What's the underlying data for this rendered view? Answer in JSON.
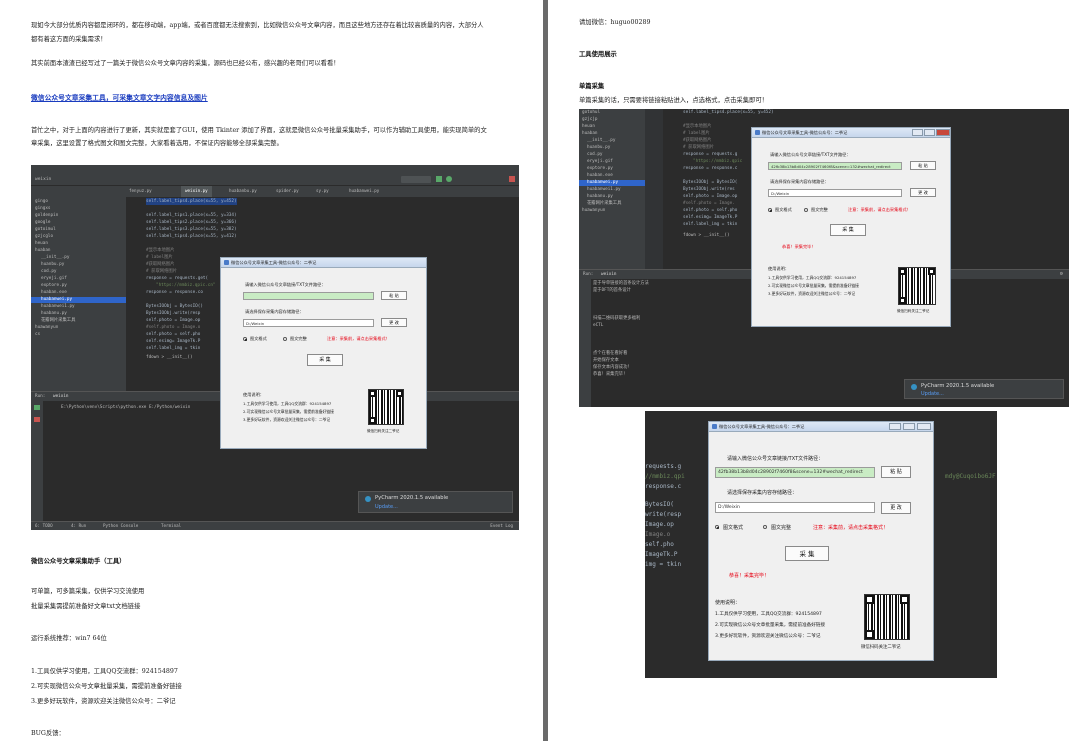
{
  "left_page": {
    "intro_1": "现如今大部分优质内容都是闭环的，都在移动端，app端，或者百度都无法搜索到，比如微信公众号文章内容，而且这些地方还存在着比较高质量的内容，大部分人",
    "intro_2": "都有着这方面的采集需求！",
    "intro_3": "其实前面本渣渣已经写过了一篇关于微信公众号文章内容的采集，源码也已经公布，感兴趣的老哥们可以看看！",
    "link_text": "微信公众号文章采集工具，可采集文章文字内容信息及图片",
    "update_1": "首忙之中，对于上面的内容进行了更新，其实就是套了GUI，使用 Tkinter 添加了界面，这就是微信公众号批量采集助手，可以作为辅助工具使用，能实现简单的文",
    "update_2": "章采集，这里设置了格式图文和图文完整，大家看着选用，不保证内容能够全部采集完整。",
    "section_title": "微信公众号文章采集助手（工具）",
    "p1": "可单篇，可多篇采集，仅供学习交流使用",
    "p2": "批量采集需提前准备好文章txt文档链接",
    "sys_req": "运行系统推荐：win7 64位",
    "note_1": "1.工具仅供学习使用，工具QQ交流群：924154897",
    "note_2": "2.可实现微信公众号文章批量采集，需提前准备好链接",
    "note_3": "3.更多好玩软件，资源欢迎关注微信公众号：二爷记",
    "bug": "BUG反馈："
  },
  "right_page": {
    "contact": "请加微信：huguo00289",
    "section_title": "工具使用展示",
    "single_title": "单篇采集",
    "single_desc": "单篇采集的话，只需要将链接粘贴进入，点选格式，点击采集即可！"
  },
  "ide_main": {
    "window_title": "weixin",
    "tabs": [
      "fenyuz.py",
      "weixin.py",
      "huabanbu.py",
      "spider.py",
      "sy.py",
      "huabanwei.py"
    ],
    "run_tab": "weixin",
    "run_cmd": "E:\\Python\\venv\\Scripts\\python.exe E:/Python/weixin",
    "status_items": [
      "6: TODO",
      "4: Run",
      "Python Console",
      "Terminal",
      "Event Log"
    ],
    "tree": [
      "gingo",
      "gingxs",
      "goldenpin",
      "google",
      "gotoimul",
      "gzjcglo",
      "heuan",
      "huaban",
      "__init__.py",
      "huanbu.py",
      "cod.py",
      "eryeji.gif",
      "exptore.py",
      "huaban.exe",
      "huabanwei.py",
      "huabanwei1.py",
      "huabanu.py",
      "花瓣网片采集工具",
      "huawanyun",
      "cs"
    ],
    "code": [
      "self.label_tips4.place(x=55, y=452)",
      "self.label_tips1.place(x=55, y=334)",
      "self.label_tips2.place(x=55, y=366)",
      "self.label_tips3.place(x=55, y=382)",
      "self.label_tips4.place(x=55, y=412)",
      "#显示本地图片",
      "# label图片",
      "#获取网络图片",
      "# 获取网络图片",
      "response = requests.get(",
      "\"https://mmbiz.qpic.cn\"",
      "response = response.co",
      "BytesIOObj = BytesIO()",
      "BytesIOObj.write(resp",
      "self.photo = Image.op",
      "#self.photo = Image.o",
      "self.photo = self.pho",
      "self.esimg= ImageTk.P",
      "self.label_img = tkin",
      "fdown > __init__()"
    ],
    "notification_title": "PyCharm 2020.1.5 available",
    "notification_link": "Update..."
  },
  "ide_right": {
    "tree": [
      "gotohul",
      "gzjcjp",
      "heuan",
      "huaban",
      "__init__.py",
      "huanbu.py",
      "cod.py",
      "eryeji.gif",
      "exptore.py",
      "huaban.exe",
      "huabanwei.py",
      "huabanwei1.py",
      "huabanu.py",
      "花瓣网片采集工具",
      "huawanyun"
    ],
    "code": [
      "self.label_tips4.place(x=55, y=452)",
      "#显示本地图片",
      "# label图片",
      "#获取网络图片",
      "# 获取网络图片",
      "response = requests.g",
      "\"https://mmbiz.qpic",
      "response = response.c",
      "BytesIOObj = BytesIO(",
      "BytesIOObj.write(res",
      "self.photo = Image.op",
      "#self.photo = Image.",
      "self.photo = self.pho",
      "self.esimg= ImageTk.P",
      "self.label_img = tkin",
      "fdown > __init__()"
    ],
    "run_tab": "weixin",
    "console": [
      "是于导单链接的首条设计方法",
      "是于DFT的首条设计",
      "",
      "",
      "扫描二维码获取更多福利",
      "eCTL",
      "",
      "",
      "点个在看在看好看",
      "开始保存文本",
      "保存文本内容成功！",
      "恭喜！采集完毕！"
    ],
    "notification_title": "PyCharm 2020.1.5 available",
    "notification_link": "Update..."
  },
  "dialog": {
    "title": "微信公众号文章采集工具-微信公众号：二爷记",
    "prompt_url": "请输入微信公众号文章链接/TXT文件路径：",
    "url_value": "42fb38b13b8d04c28902f7460f8&scene=132#wechat_redirect",
    "btn_confirm": "粘 贴",
    "prompt_save": "请选择保存采集内容存储路径：",
    "save_value": "D:/Weixin",
    "btn_change": "更 改",
    "radio_1": "图文格式",
    "radio_2": "图文完整",
    "warning": "注意：采集前，请点击采集格式！",
    "btn_collect": "采 集",
    "done_msg": "恭喜！采集完毕！",
    "help_title": "使用说明：",
    "help_1": "1.工具仅供学习使用，工具QQ交流群：924154897",
    "help_2": "2.可实现微信公众号文章批量采集，需提前准备好链接",
    "help_3": "3.更多好玩软件，资源欢迎关注微信公众号：二爷记",
    "qr_caption": "微信扫码关注二爷记"
  }
}
